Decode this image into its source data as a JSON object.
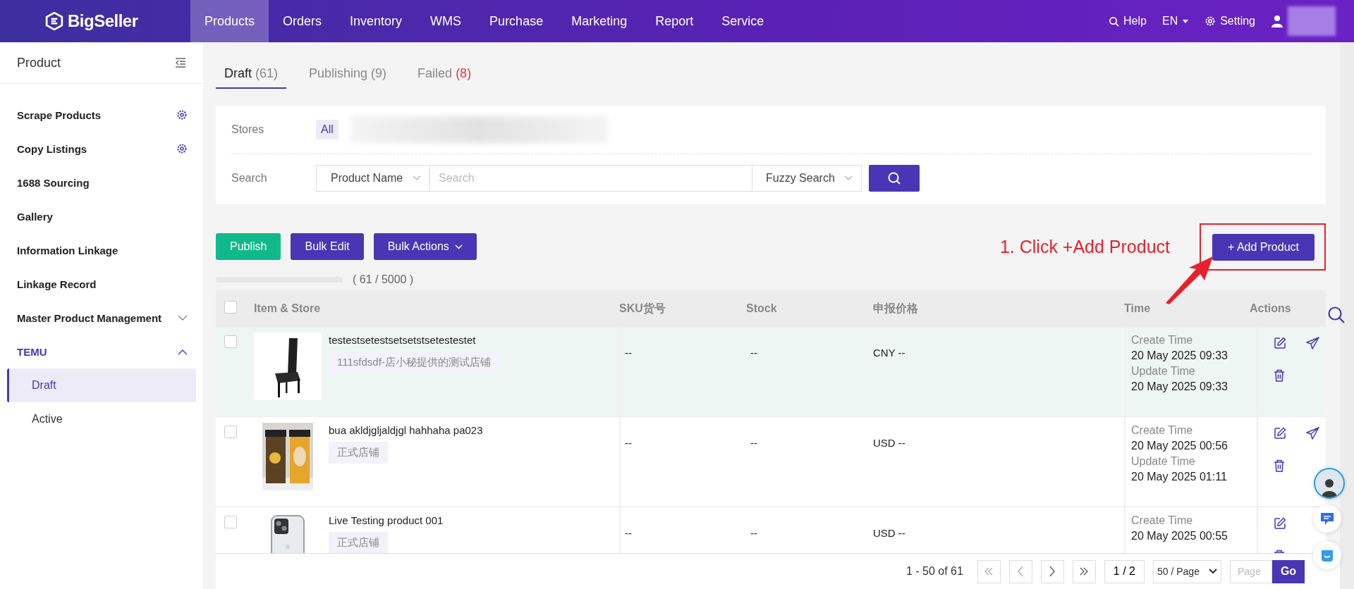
{
  "topbar": {
    "logo": "BigSeller",
    "nav": [
      {
        "label": "Products",
        "selected": true
      },
      {
        "label": "Orders",
        "selected": false
      },
      {
        "label": "Inventory",
        "selected": false
      },
      {
        "label": "WMS",
        "selected": false
      },
      {
        "label": "Purchase",
        "selected": false
      },
      {
        "label": "Marketing",
        "selected": false
      },
      {
        "label": "Report",
        "selected": false
      },
      {
        "label": "Service",
        "selected": false
      }
    ],
    "help": "Help",
    "language": "EN",
    "setting": "Setting"
  },
  "sidebar": {
    "title": "Product",
    "items": [
      {
        "label": "Scrape Products",
        "kind": "gear"
      },
      {
        "label": "Copy Listings",
        "kind": "gear"
      },
      {
        "label": "1688 Sourcing",
        "kind": "plain"
      },
      {
        "label": "Gallery",
        "kind": "plain"
      },
      {
        "label": "Information Linkage",
        "kind": "plain"
      },
      {
        "label": "Linkage Record",
        "kind": "plain"
      },
      {
        "label": "Master Product Management",
        "kind": "group",
        "expanded": false
      },
      {
        "label": "TEMU",
        "kind": "group",
        "expanded": true,
        "children": [
          {
            "label": "Draft",
            "selected": true
          },
          {
            "label": "Active",
            "selected": false
          }
        ]
      }
    ]
  },
  "tabs": [
    {
      "label": "Draft",
      "count": "(61)",
      "selected": true,
      "alert": false
    },
    {
      "label": "Publishing",
      "count": "(9)",
      "selected": false,
      "alert": false
    },
    {
      "label": "Failed",
      "count": "(8)",
      "selected": false,
      "alert": true
    }
  ],
  "filters": {
    "stores_label": "Stores",
    "stores_all": "All",
    "search_label": "Search",
    "search_type": "Product Name",
    "search_placeholder": "Search",
    "match_mode": "Fuzzy Search"
  },
  "actions": {
    "publish": "Publish",
    "bulk_edit": "Bulk Edit",
    "bulk_actions": "Bulk Actions",
    "add_product": "+ Add Product"
  },
  "quota": {
    "text": "( 61 / 5000 )"
  },
  "annotation": {
    "text": "1. Click +Add Product"
  },
  "table": {
    "columns": [
      "Item & Store",
      "SKU货号",
      "Stock",
      "申报价格",
      "Time",
      "Actions"
    ],
    "select_all_checked": false,
    "rows": [
      {
        "checked": false,
        "highlighted": true,
        "name": "testestsetestsetsetstsetestestet",
        "store": "111sfdsdf-店小秘提供的测试店铺",
        "sku": "--",
        "stock": "--",
        "price": "CNY --",
        "create_label": "Create Time",
        "create_time": "20 May 2025 09:33",
        "update_label": "Update Time",
        "update_time": "20 May 2025 09:33"
      },
      {
        "checked": false,
        "highlighted": false,
        "name": "bua akldjgljaldjgl hahhaha pa023",
        "store": "正式店铺",
        "sku": "--",
        "stock": "--",
        "price": "USD --",
        "create_label": "Create Time",
        "create_time": "20 May 2025 00:56",
        "update_label": "Update Time",
        "update_time": "20 May 2025 01:11"
      },
      {
        "checked": false,
        "highlighted": false,
        "name": "Live Testing product 001",
        "store": "正式店铺",
        "sku": "--",
        "stock": "--",
        "price": "USD --",
        "create_label": "Create Time",
        "create_time": "20 May 2025 00:55"
      }
    ]
  },
  "pagination": {
    "summary": "1 - 50 of 61",
    "page": "1 / 2",
    "page_size": "50 / Page",
    "jump_placeholder": "Page",
    "go": "Go"
  }
}
